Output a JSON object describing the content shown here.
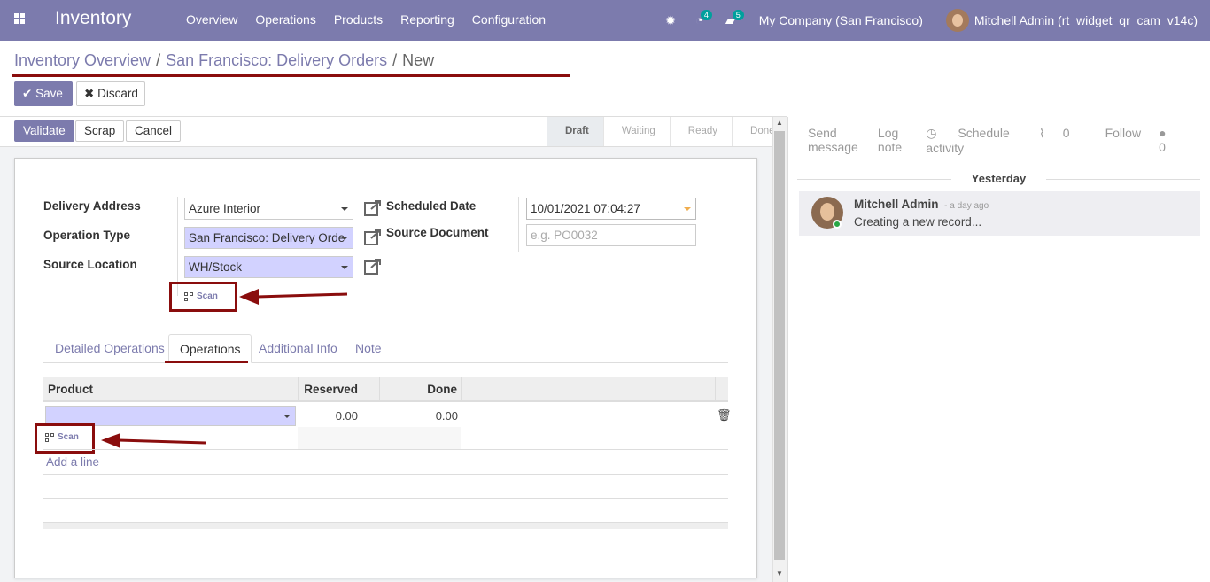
{
  "nav": {
    "brand": "Inventory",
    "menu": [
      "Overview",
      "Operations",
      "Products",
      "Reporting",
      "Configuration"
    ],
    "activity_count": "4",
    "message_count": "5",
    "company": "My Company (San Francisco)",
    "user": "Mitchell Admin (rt_widget_qr_cam_v14c)"
  },
  "breadcrumb": {
    "first": "Inventory Overview",
    "second": "San Francisco: Delivery Orders",
    "current": "New"
  },
  "actions": {
    "save": "Save",
    "discard": "Discard",
    "validate": "Validate",
    "scrap": "Scrap",
    "cancel": "Cancel"
  },
  "stages": [
    "Draft",
    "Waiting",
    "Ready",
    "Done"
  ],
  "form": {
    "delivery_address_label": "Delivery Address",
    "delivery_address": "Azure Interior",
    "operation_type_label": "Operation Type",
    "operation_type": "San Francisco: Delivery Orde",
    "source_location_label": "Source Location",
    "source_location": "WH/Stock",
    "scheduled_date_label": "Scheduled Date",
    "scheduled_date": "10/01/2021 07:04:27",
    "source_document_label": "Source Document",
    "source_document_placeholder": "e.g. PO0032",
    "scan": "Scan"
  },
  "tabs": [
    "Detailed Operations",
    "Operations",
    "Additional Info",
    "Note"
  ],
  "ops_table": {
    "headers": [
      "Product",
      "Reserved",
      "Done"
    ],
    "row": {
      "reserved": "0.00",
      "done": "0.00"
    },
    "scan": "Scan",
    "add_line": "Add a line"
  },
  "chatter": {
    "send_message": "Send message",
    "log_note": "Log note",
    "schedule_activity": "Schedule activity",
    "attachments": "0",
    "follow": "Follow",
    "followers": "0",
    "day": "Yesterday",
    "author": "Mitchell Admin",
    "time": "- a day ago",
    "body": "Creating a new record..."
  },
  "colors": {
    "brand": "#7c7bad",
    "highlight": "#8a0d0d",
    "required": "#d2d2ff"
  }
}
